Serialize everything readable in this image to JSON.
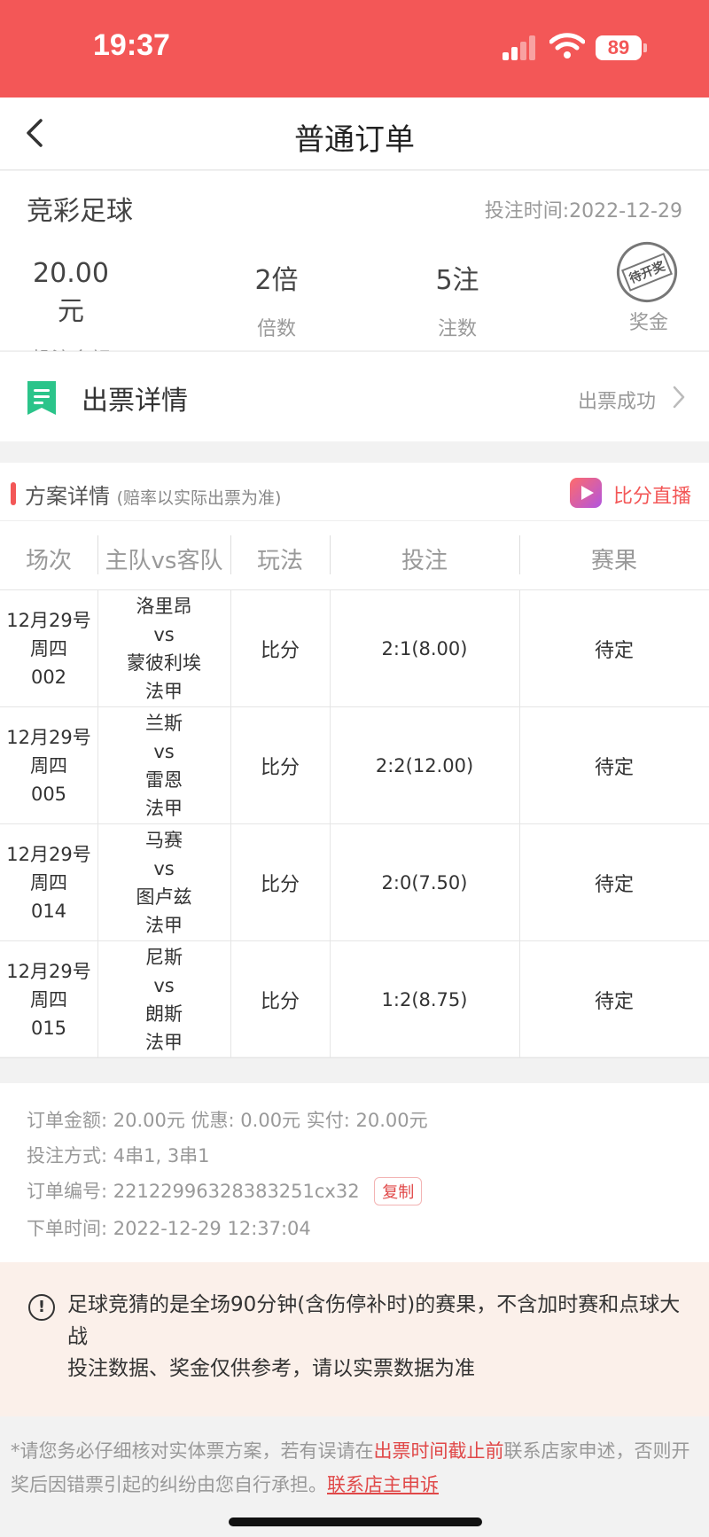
{
  "status": {
    "time": "19:37",
    "battery": "89"
  },
  "nav": {
    "title": "普通订单"
  },
  "summary": {
    "game": "竞彩足球",
    "bet_time": "投注时间:2022-12-29",
    "amount_value": "20.00元",
    "amount_label": "投注金额",
    "multiplier_value": "2倍",
    "multiplier_label": "倍数",
    "bets_value": "5注",
    "bets_label": "注数",
    "prize_stamp": "待开奖",
    "prize_label": "奖金"
  },
  "ticket": {
    "title": "出票详情",
    "status": "出票成功"
  },
  "plan": {
    "title": "方案详情",
    "note": "(赔率以实际出票为准)",
    "live_label": "比分直播",
    "headers": [
      "场次",
      "主队vs客队",
      "玩法",
      "投注",
      "赛果"
    ],
    "rows": [
      {
        "date": "12月29号",
        "weekday": "周四",
        "no": "002",
        "home": "洛里昂",
        "vs": "vs",
        "away": "蒙彼利埃",
        "league": "法甲",
        "play": "比分",
        "bet": "2:1(8.00)",
        "result": "待定"
      },
      {
        "date": "12月29号",
        "weekday": "周四",
        "no": "005",
        "home": "兰斯",
        "vs": "vs",
        "away": "雷恩",
        "league": "法甲",
        "play": "比分",
        "bet": "2:2(12.00)",
        "result": "待定"
      },
      {
        "date": "12月29号",
        "weekday": "周四",
        "no": "014",
        "home": "马赛",
        "vs": "vs",
        "away": "图卢兹",
        "league": "法甲",
        "play": "比分",
        "bet": "2:0(7.50)",
        "result": "待定"
      },
      {
        "date": "12月29号",
        "weekday": "周四",
        "no": "015",
        "home": "尼斯",
        "vs": "vs",
        "away": "朗斯",
        "league": "法甲",
        "play": "比分",
        "bet": "1:2(8.75)",
        "result": "待定"
      }
    ]
  },
  "order": {
    "amounts": "订单金额: 20.00元   优惠: 0.00元   实付: 20.00元",
    "method": "投注方式: 4串1, 3串1",
    "number": "订单编号: 22122996328383251cx32",
    "copy_label": "复制",
    "placed": "下单时间: 2022-12-29 12:37:04"
  },
  "notice": {
    "icon": "!",
    "line1": "足球竞猜的是全场90分钟(含伤停补时)的赛果，不含加时赛和点球大战",
    "line2": "投注数据、奖金仅供参考，请以实票数据为准"
  },
  "disclaimer": {
    "part1": "*请您务必仔细核对实体票方案，若有误请在",
    "highlight": "出票时间截止前",
    "part2": "联系店家申述，否则开奖后因错票引起的纠纷由您自行承担。",
    "link": "联系店主申诉"
  },
  "colors": {
    "accent": "#f35757",
    "ticket_icon": "#2bc48a"
  }
}
